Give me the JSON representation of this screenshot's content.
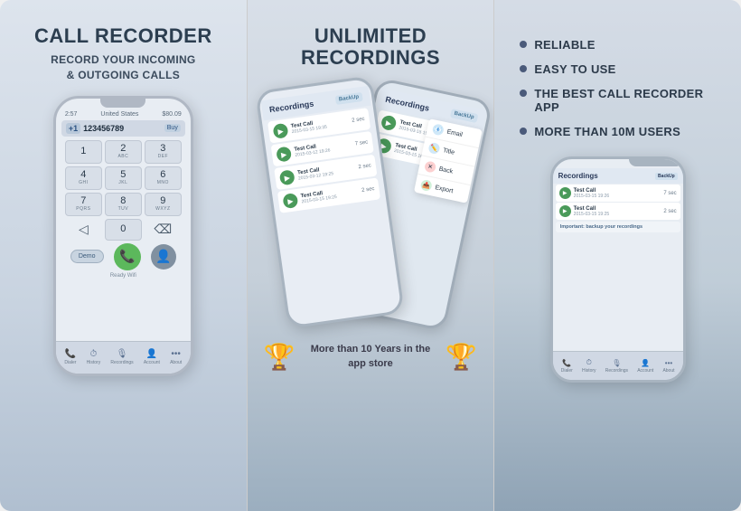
{
  "panel1": {
    "title": "CALL RECORDER",
    "subtitle": "RECORD YOUR INCOMING\n& OUTGOING CALLS",
    "dialer": {
      "time": "2:57",
      "location": "United States",
      "balance": "$80.09",
      "cc": "+1",
      "number": "123456789",
      "buy_label": "Buy",
      "keys": [
        {
          "num": "1",
          "letters": ""
        },
        {
          "num": "2",
          "letters": "ABC"
        },
        {
          "num": "3",
          "letters": "DEF"
        },
        {
          "num": "4",
          "letters": "GHI"
        },
        {
          "num": "5",
          "letters": "JKL"
        },
        {
          "num": "6",
          "letters": "MNO"
        },
        {
          "num": "7",
          "letters": "PQRS"
        },
        {
          "num": "8",
          "letters": "TUV"
        },
        {
          "num": "9",
          "letters": "WXYZ"
        }
      ],
      "zero": "0",
      "ready_label": "Ready Wifi",
      "demo_label": "Demo"
    },
    "bottom_tabs": [
      {
        "icon": "📞",
        "label": "Dialer"
      },
      {
        "icon": "⏱",
        "label": "History"
      },
      {
        "icon": "🎙",
        "label": "Recordings"
      },
      {
        "icon": "👤",
        "label": "Account"
      },
      {
        "icon": "•••",
        "label": "About"
      }
    ]
  },
  "panel2": {
    "title": "UNLIMITED\nRECORDINGS",
    "recordings_header": "Recordings",
    "backup_label": "BackUp",
    "recordings": [
      {
        "title": "Test Call",
        "date": "2015-03-15 19:35",
        "duration": "2 sec"
      },
      {
        "title": "Test Call",
        "date": "2015-03-15 19:25",
        "duration": "2 sec"
      },
      {
        "title": "Test Call",
        "date": "2015-03-15 16:38",
        "duration": "2 sec"
      },
      {
        "title": "Test Call",
        "date": "2015-03-12 19:26",
        "duration": "7 sec"
      },
      {
        "title": "Test Call",
        "date": "2015-03-12 19:25",
        "duration": "2 sec"
      }
    ],
    "context_menu": [
      {
        "icon": "📧",
        "label": "Email",
        "color": "#e8f0f8"
      },
      {
        "icon": "✏️",
        "label": "Title",
        "color": "#e8f0f8"
      },
      {
        "icon": "❌",
        "label": "Back",
        "color": "#fce8e8"
      },
      {
        "icon": "📤",
        "label": "Export",
        "color": "#e8f8e8"
      }
    ],
    "laurel_text": "More than 10 Years\nin the app store"
  },
  "panel3": {
    "features": [
      "RELIABLE",
      "EASY TO USE",
      "THE BEST CALL RECORDER APP",
      "MORE THAN 10M USERS"
    ],
    "important_banner": "Important: backup your recordings",
    "recordings_header": "Recordings",
    "bottom_tabs": [
      {
        "icon": "📞",
        "label": "Dialer"
      },
      {
        "icon": "⏱",
        "label": "History"
      },
      {
        "icon": "🎙",
        "label": "Recordings"
      },
      {
        "icon": "👤",
        "label": "Account"
      },
      {
        "icon": "•••",
        "label": "About"
      }
    ],
    "recordings": [
      {
        "title": "Test Call",
        "date": "2015-03-15 19:26",
        "duration": "7 sec"
      },
      {
        "title": "Test Call",
        "date": "2015-03-15 19:25",
        "duration": "2 sec"
      }
    ]
  }
}
